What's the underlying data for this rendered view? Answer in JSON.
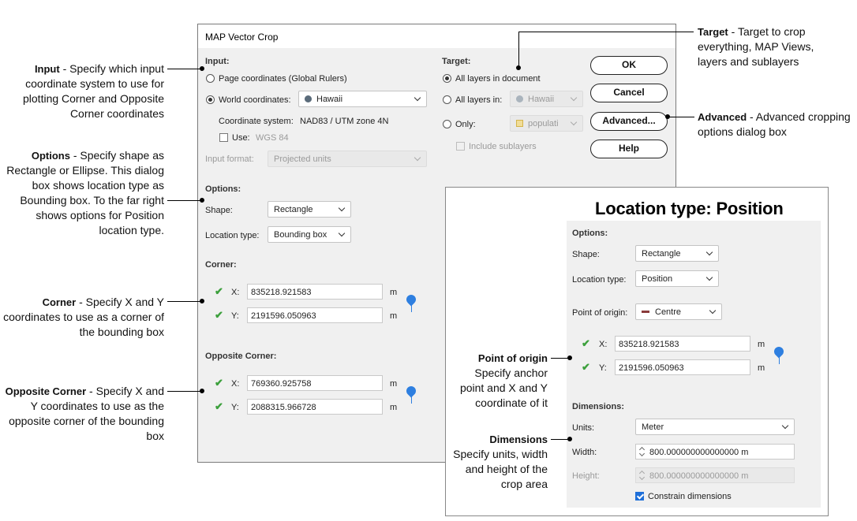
{
  "dialog": {
    "title": "MAP Vector Crop",
    "input": {
      "section": "Input:",
      "page_coords": "Page coordinates (Global Rulers)",
      "world_coords": "World coordinates:",
      "world_value": "Hawaii",
      "coord_system_label": "Coordinate system:",
      "coord_system_value": "NAD83 / UTM zone 4N",
      "use_label": "Use:",
      "use_value": "WGS 84",
      "format_label": "Input format:",
      "format_value": "Projected units"
    },
    "target": {
      "section": "Target:",
      "all_layers_doc": "All layers in document",
      "all_layers_in": "All layers in:",
      "all_layers_in_value": "Hawaii",
      "only": "Only:",
      "only_value": "populati",
      "include_sublayers": "Include sublayers"
    },
    "buttons": {
      "ok": "OK",
      "cancel": "Cancel",
      "advanced": "Advanced...",
      "help": "Help"
    },
    "options": {
      "section": "Options:",
      "shape_label": "Shape:",
      "shape_value": "Rectangle",
      "loc_label": "Location type:",
      "loc_value": "Bounding box"
    },
    "corner": {
      "section": "Corner:",
      "x_label": "X:",
      "x_value": "835218.921583",
      "y_label": "Y:",
      "y_value": "2191596.050963",
      "unit": "m"
    },
    "opposite": {
      "section": "Opposite Corner:",
      "x_label": "X:",
      "x_value": "769360.925758",
      "y_label": "Y:",
      "y_value": "2088315.966728",
      "unit": "m"
    }
  },
  "panel": {
    "title": "Location type: Position",
    "options_section": "Options:",
    "shape_label": "Shape:",
    "shape_value": "Rectangle",
    "loc_label": "Location type:",
    "loc_value": "Position",
    "origin_label": "Point of origin:",
    "origin_value": "Centre",
    "x_label": "X:",
    "x_value": "835218.921583",
    "y_label": "Y:",
    "y_value": "2191596.050963",
    "unit": "m",
    "dimensions_section": "Dimensions:",
    "units_label": "Units:",
    "units_value": "Meter",
    "width_label": "Width:",
    "width_value": "800.000000000000000 m",
    "height_label": "Height:",
    "height_value": "800.000000000000000 m",
    "constrain": "Constrain dimensions"
  },
  "callouts": {
    "input": {
      "head": "Input",
      "body": " - Specify which input coordinate system to use for plotting Corner and Opposite Corner coordinates"
    },
    "options": {
      "head": "Options",
      "body": " - Specify shape as Rectangle or Ellipse. This dialog box shows location type as Bounding box. To the far right shows options for Position location type."
    },
    "corner": {
      "head": "Corner",
      "body": " - Specify X and Y coordinates to use as a corner of the bounding box"
    },
    "opposite": {
      "head": "Opposite Corner",
      "body": " - Specify X and Y coordinates to use as the opposite corner of the bounding box"
    },
    "target": {
      "head": "Target",
      "body": " - Target to crop everything, MAP Views, layers and sublayers"
    },
    "advanced": {
      "head": "Advanced",
      "body": " - Advanced cropping options dialog box"
    },
    "origin": {
      "head": "Point of origin",
      "body": "Specify anchor point and X and Y coordinate of it"
    },
    "dimensions": {
      "head": "Dimensions",
      "body": "Specify units, width and height of the crop area"
    }
  }
}
